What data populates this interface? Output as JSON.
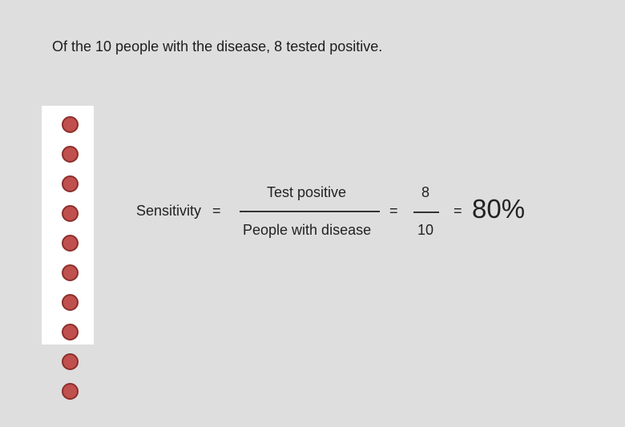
{
  "headline": "Of the 10 people with the disease, 8 tested positive.",
  "people": {
    "total": 10,
    "positive": 8,
    "dot_color": "#c0504d",
    "highlight_color": "#ffffff"
  },
  "formula": {
    "label": "Sensitivity",
    "equals_1": "=",
    "numerator": "Test positive",
    "denominator": "People with disease",
    "equals_2": "=",
    "num_value": "8",
    "den_value": "10",
    "equals_3": "=",
    "result": "80%"
  }
}
